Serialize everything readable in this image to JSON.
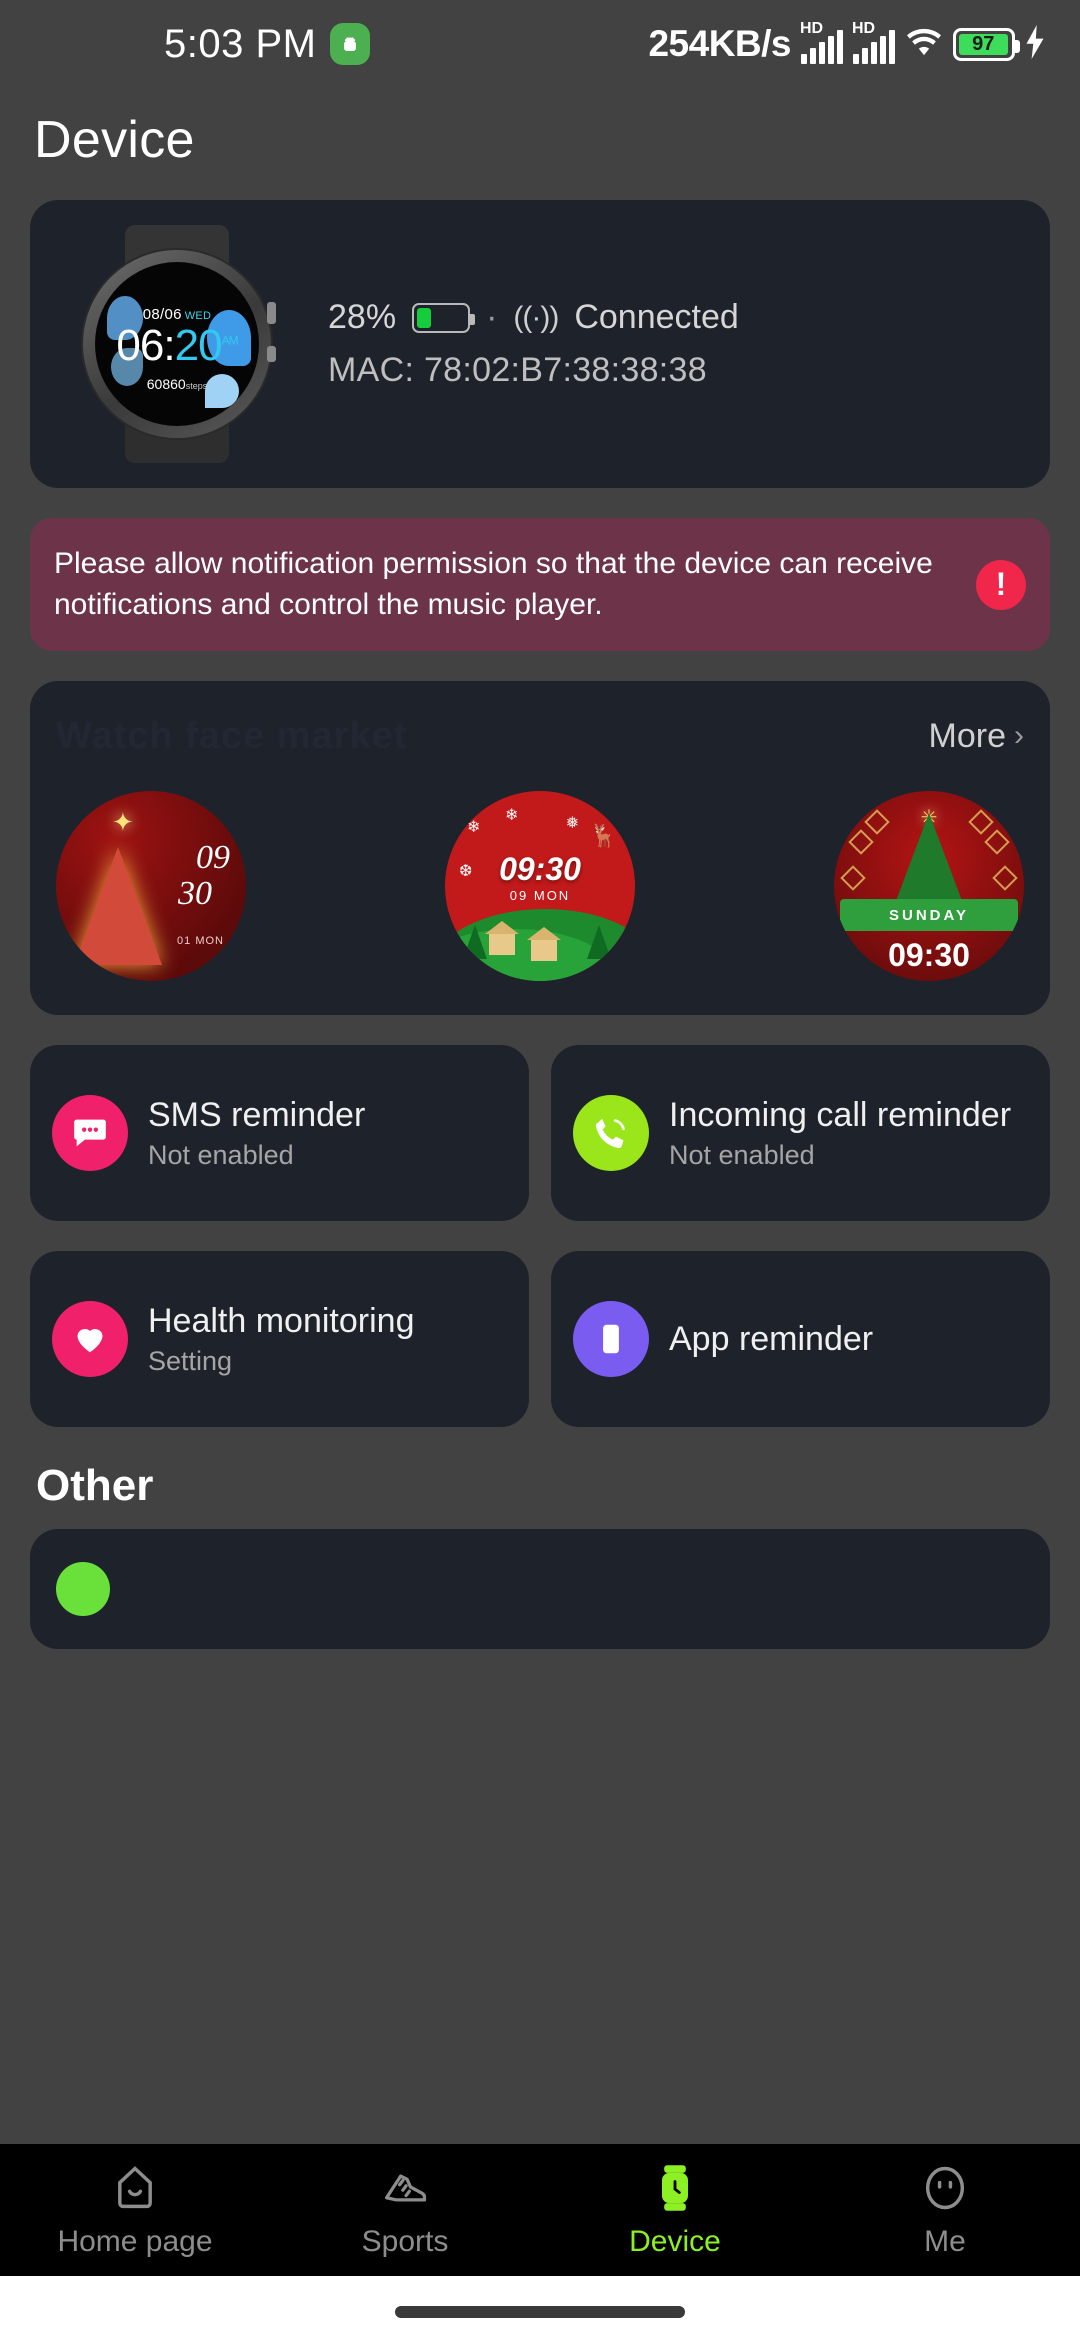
{
  "status_bar": {
    "time": "5:03 PM",
    "android_icon": "android-robot-icon",
    "network_speed": "254KB/s",
    "signal_1_label": "HD",
    "signal_2_label": "HD",
    "wifi_icon": "wifi-icon",
    "battery_percent": "97",
    "charging_icon": "charging-bolt-icon"
  },
  "header": {
    "title": "Device"
  },
  "device": {
    "watch_face": {
      "date": "08/06",
      "weekday": "WED",
      "hour": "06",
      "minute": "20",
      "meridiem": "AM",
      "steps": "60860",
      "steps_unit": "steps"
    },
    "battery_percent": "28%",
    "separator": "·",
    "connection_icon": "((·))",
    "connection_status": "Connected",
    "mac_label": "MAC:",
    "mac_address": "78:02:B7:38:38:38",
    "mac_full": "MAC: 78:02:B7:38:38:38"
  },
  "notice": {
    "message": "Please allow notification permission so that the device can receive notifications and control the music player.",
    "badge": "!",
    "badge_color": "#f0264a",
    "background_color": "#6d3349"
  },
  "watch_faces": {
    "section_title": "Watch face market",
    "more_label": "More",
    "chevron": "›",
    "items": [
      {
        "name": "christmas-tree-face",
        "time": "09 30",
        "time_line1": "09",
        "time_line2": "30",
        "sub": "01 MON"
      },
      {
        "name": "snow-village-face",
        "time": "09:30",
        "sub": "09  MON"
      },
      {
        "name": "sunday-ribbon-face",
        "time": "09:30",
        "ribbon": "SUNDAY"
      }
    ]
  },
  "reminders": [
    {
      "name": "sms-reminder",
      "icon": "message-icon",
      "icon_color": "#f0216a",
      "title": "SMS reminder",
      "subtitle": "Not enabled"
    },
    {
      "name": "incoming-call-reminder",
      "icon": "phone-icon",
      "icon_color": "#9ae61a",
      "title": "Incoming call reminder",
      "subtitle": "Not enabled"
    },
    {
      "name": "health-monitoring",
      "icon": "heart-icon",
      "icon_color": "#f0216a",
      "title": "Health monitoring",
      "subtitle": "Setting"
    },
    {
      "name": "app-reminder",
      "icon": "phone-app-icon",
      "icon_color": "#7b5cf0",
      "title": "App reminder",
      "subtitle": ""
    }
  ],
  "other": {
    "title": "Other"
  },
  "bottom_nav": {
    "items": [
      {
        "name": "home-page",
        "icon": "home-icon",
        "label": "Home page",
        "active": false
      },
      {
        "name": "sports",
        "icon": "shoe-icon",
        "label": "Sports",
        "active": false
      },
      {
        "name": "device",
        "icon": "watch-icon",
        "label": "Device",
        "active": true
      },
      {
        "name": "me",
        "icon": "face-icon",
        "label": "Me",
        "active": false
      }
    ],
    "active_color": "#8cf024"
  }
}
